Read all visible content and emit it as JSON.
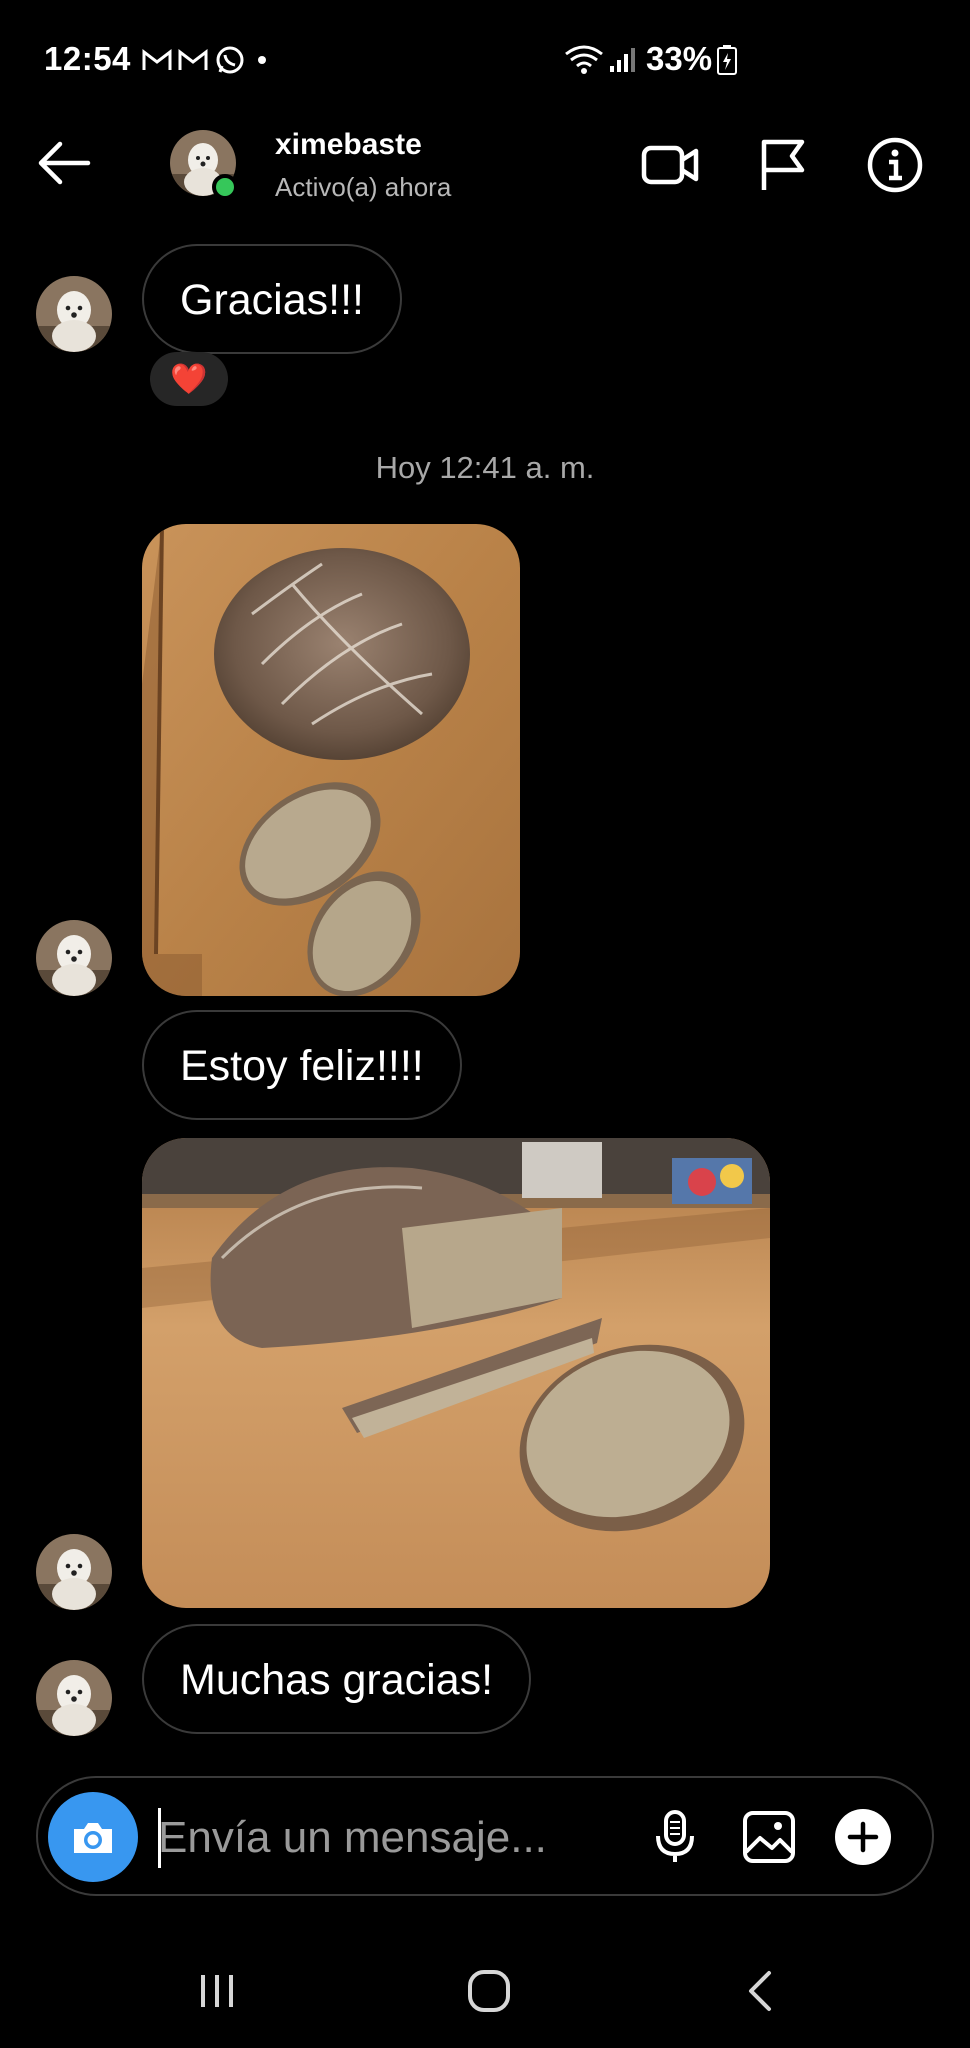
{
  "status_bar": {
    "time": "12:54",
    "battery": "33%",
    "icons": [
      "gmail-icon",
      "gmail-icon",
      "whatsapp-icon",
      "dot-icon",
      "wifi-icon",
      "signal-icon",
      "battery-charging-icon"
    ]
  },
  "header": {
    "username": "ximebaste",
    "activity": "Activo(a) ahora",
    "icons": [
      "back-arrow-icon",
      "video-call-icon",
      "flag-icon",
      "info-icon"
    ]
  },
  "messages": [
    {
      "type": "text",
      "text": "Gracias!!!",
      "reaction": "❤️"
    },
    {
      "type": "timestamp",
      "text": "Hoy 12:41 a. m."
    },
    {
      "type": "image",
      "description": "bread-loaf-top-view"
    },
    {
      "type": "text",
      "text": "Estoy feliz!!!!"
    },
    {
      "type": "image",
      "description": "bread-loaf-side-view"
    },
    {
      "type": "text",
      "text": "Muchas gracias!"
    }
  ],
  "composer": {
    "placeholder": "Envía un mensaje...",
    "value": ""
  },
  "colors": {
    "background": "#000000",
    "accent": "#3897f0",
    "online": "#36c75a",
    "bubble_border": "#3a3a3a"
  }
}
